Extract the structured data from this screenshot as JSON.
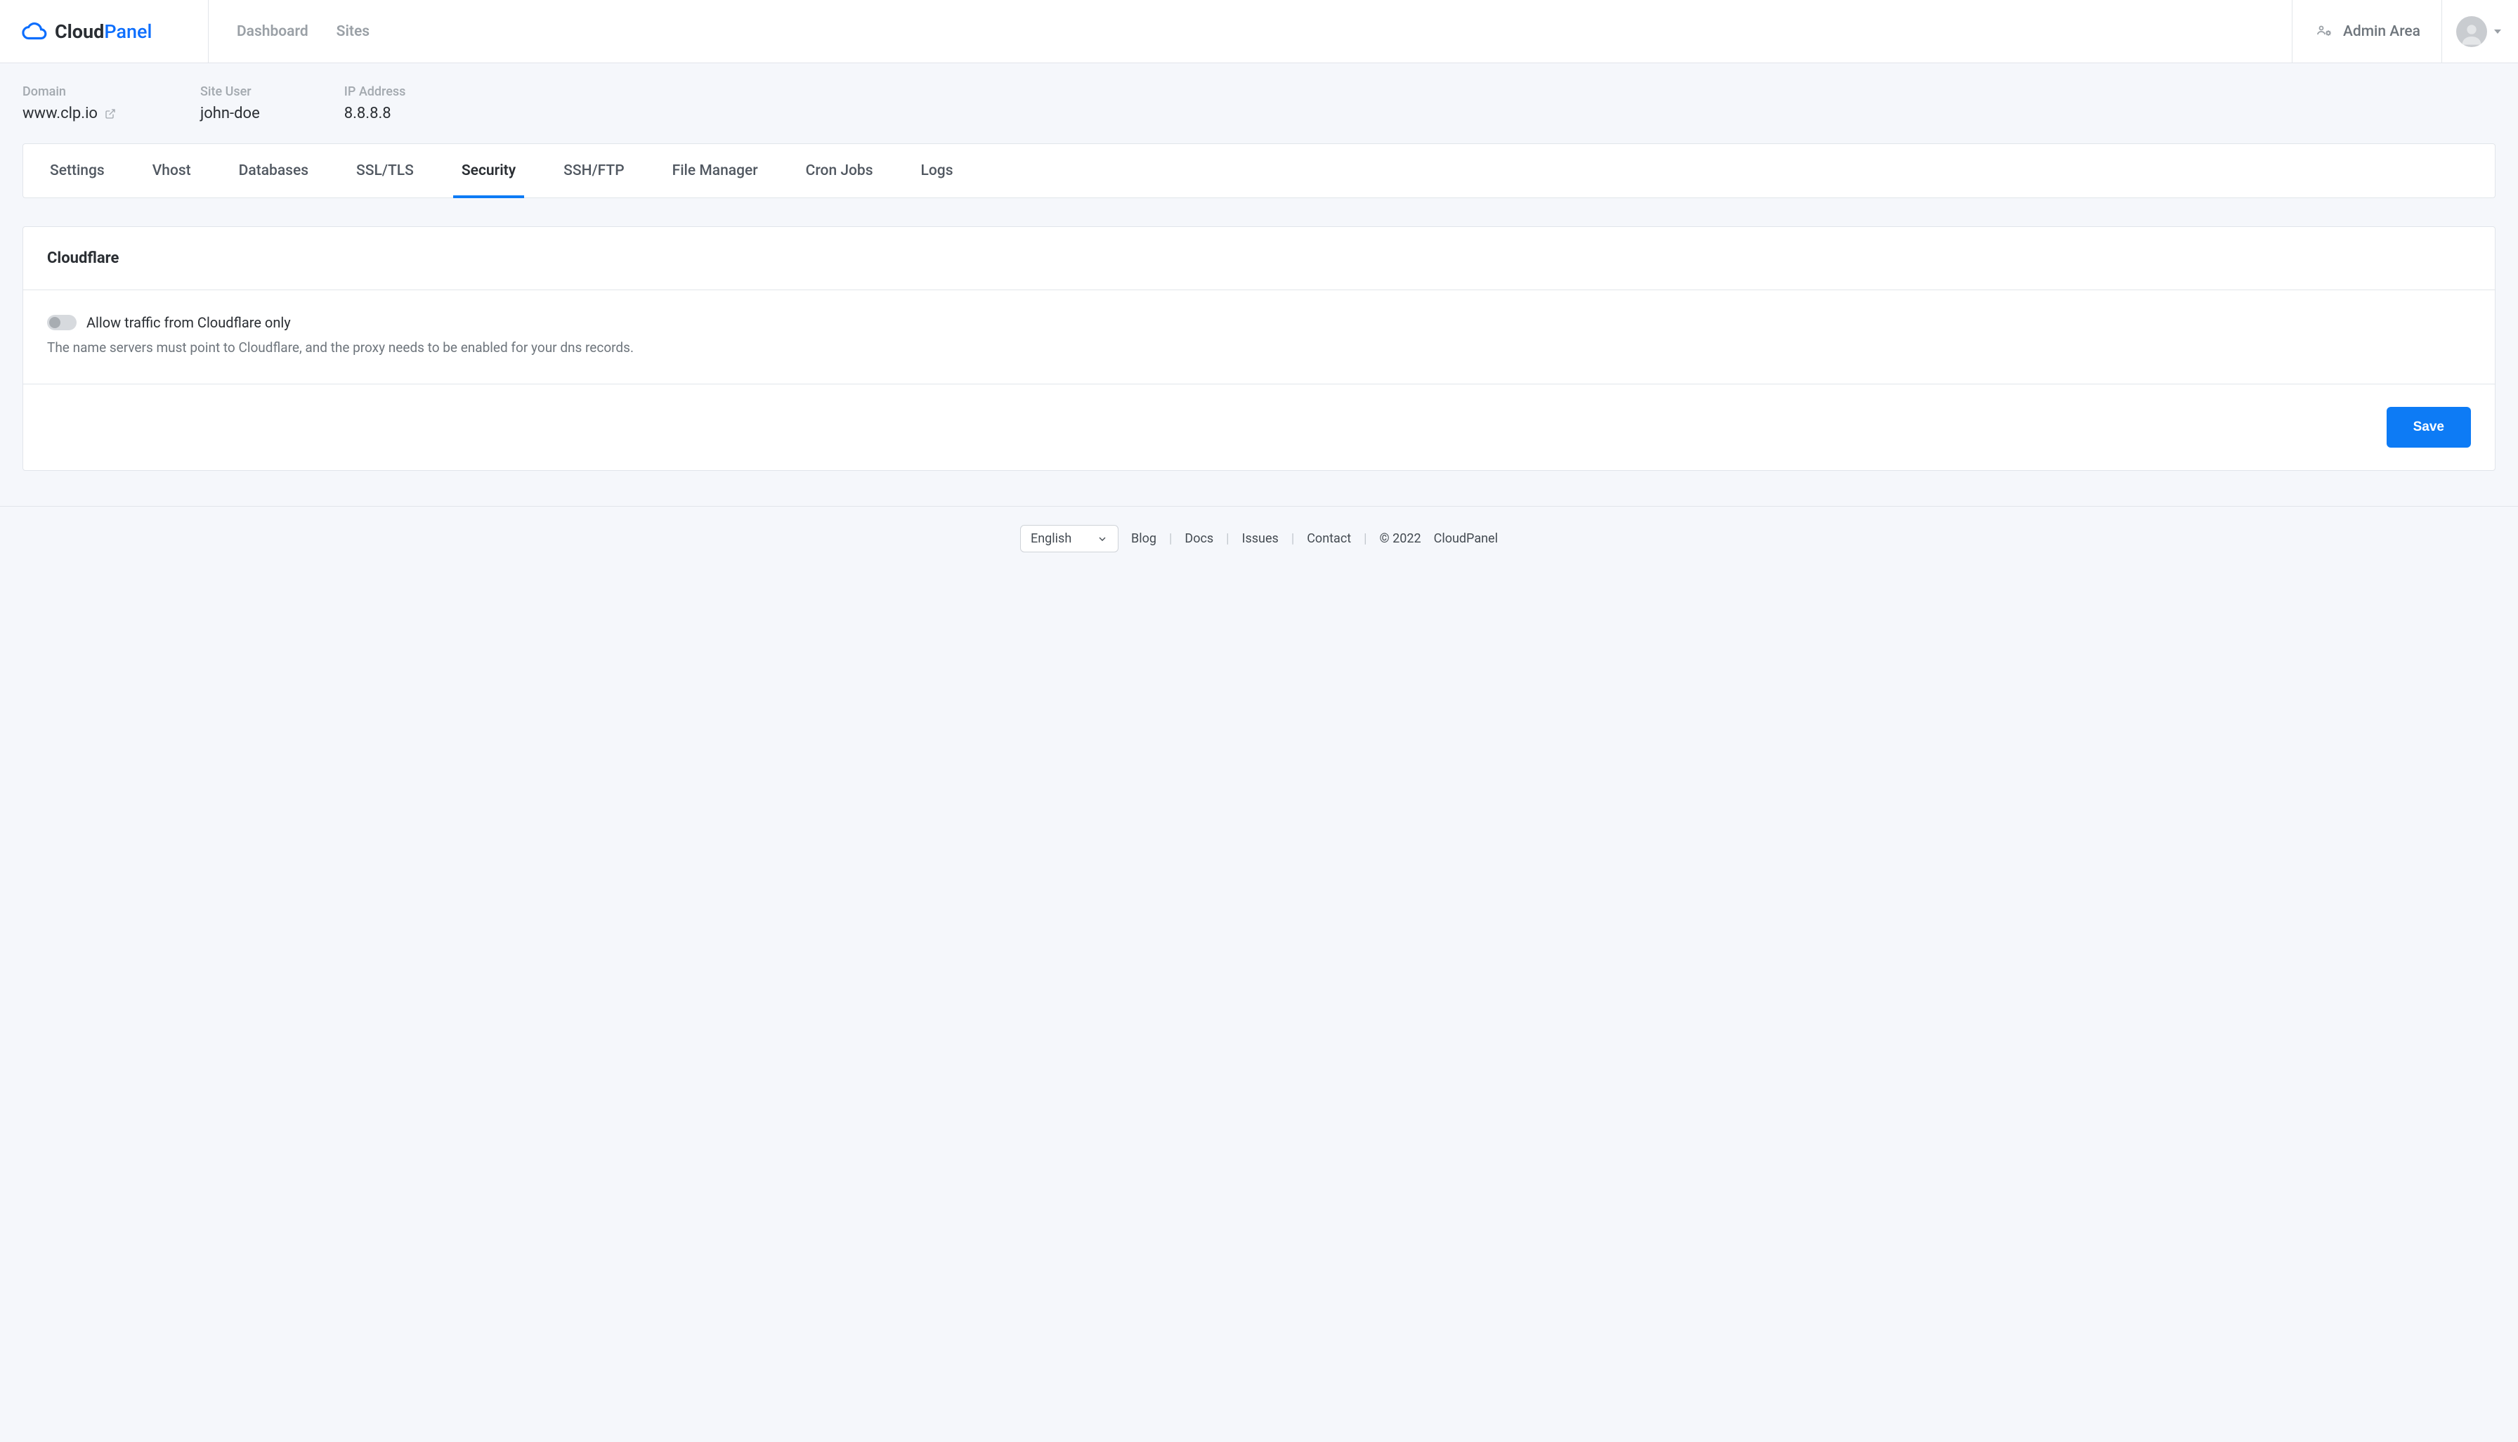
{
  "brand": {
    "part1": "Cloud",
    "part2": "Panel"
  },
  "nav": {
    "dashboard": "Dashboard",
    "sites": "Sites",
    "admin_area": "Admin Area"
  },
  "site": {
    "domain_label": "Domain",
    "domain_value": "www.clp.io",
    "user_label": "Site User",
    "user_value": "john-doe",
    "ip_label": "IP Address",
    "ip_value": "8.8.8.8"
  },
  "tabs": {
    "settings": "Settings",
    "vhost": "Vhost",
    "databases": "Databases",
    "ssl": "SSL/TLS",
    "security": "Security",
    "ssh": "SSH/FTP",
    "file_manager": "File Manager",
    "cron": "Cron Jobs",
    "logs": "Logs"
  },
  "security": {
    "title": "Cloudflare",
    "toggle_label": "Allow traffic from Cloudflare only",
    "toggle_help": "The name servers must point to Cloudflare, and the proxy needs to be enabled for your dns records.",
    "save": "Save"
  },
  "footer": {
    "language": "English",
    "blog": "Blog",
    "docs": "Docs",
    "issues": "Issues",
    "contact": "Contact",
    "copyright": "© 2022",
    "product": "CloudPanel"
  }
}
